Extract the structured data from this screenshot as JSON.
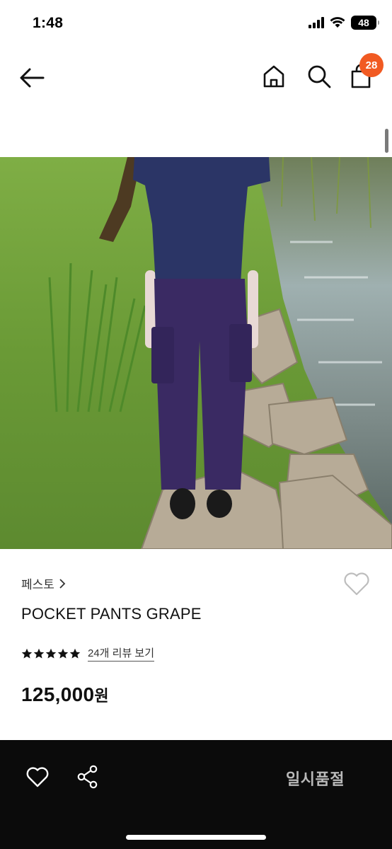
{
  "status_bar": {
    "time": "1:48",
    "battery": "48",
    "icons": [
      "signal-icon",
      "wifi-icon",
      "battery-icon"
    ]
  },
  "header": {
    "icons": [
      "back-arrow-icon",
      "home-icon",
      "search-icon",
      "shopping-bag-icon"
    ],
    "cart_count": "28",
    "badge_color": "#f15a22"
  },
  "product": {
    "brand": "페스토",
    "name": "POCKET PANTS GRAPE",
    "rating": 5,
    "review_link": "24개 리뷰 보기",
    "price": "125,000",
    "price_unit": "원"
  },
  "bottom_bar": {
    "icons": [
      "heart-icon",
      "share-icon"
    ],
    "status_label": "일시품절",
    "background": "#0b0b0b"
  }
}
